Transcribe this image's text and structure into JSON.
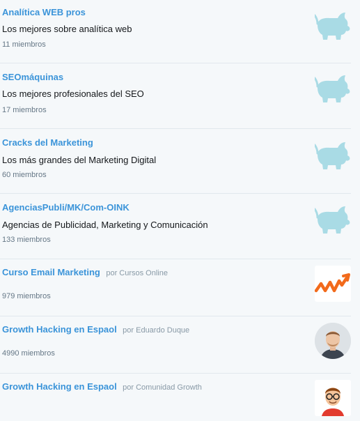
{
  "lists": [
    {
      "name": "Analítica WEB pros",
      "owner": "",
      "description": "Los mejores sobre analítica web",
      "members": "11 miembros",
      "avatar": "pig-icon"
    },
    {
      "name": "SEOmáquinas",
      "owner": "",
      "description": "Los mejores profesionales del SEO",
      "members": "17 miembros",
      "avatar": "pig-icon"
    },
    {
      "name": "Cracks del Marketing",
      "owner": "",
      "description": "Los más grandes del Marketing Digital",
      "members": "60 miembros",
      "avatar": "pig-icon"
    },
    {
      "name": "AgenciasPubli/MK/Com-OINK",
      "owner": "",
      "description": "Agencias de Publicidad, Marketing y Comunicación",
      "members": "133 miembros",
      "avatar": "pig-icon"
    },
    {
      "name": "Curso Email Marketing",
      "owner": "por Cursos Online",
      "description": "",
      "members": "979 miembros",
      "avatar": "orange-arrow-logo"
    },
    {
      "name": "Growth Hacking en Espaol",
      "owner": "por Eduardo Duque",
      "description": "",
      "members": "4990 miembros",
      "avatar": "user-photo"
    },
    {
      "name": "Growth Hacking en Espaol",
      "owner": "por Comunidad Growth",
      "description": "",
      "members": "",
      "avatar": "cartoon-avatar"
    }
  ],
  "colors": {
    "link": "#3b94d9",
    "pig": "#a9dbe5",
    "logo": "#f26a1b"
  }
}
